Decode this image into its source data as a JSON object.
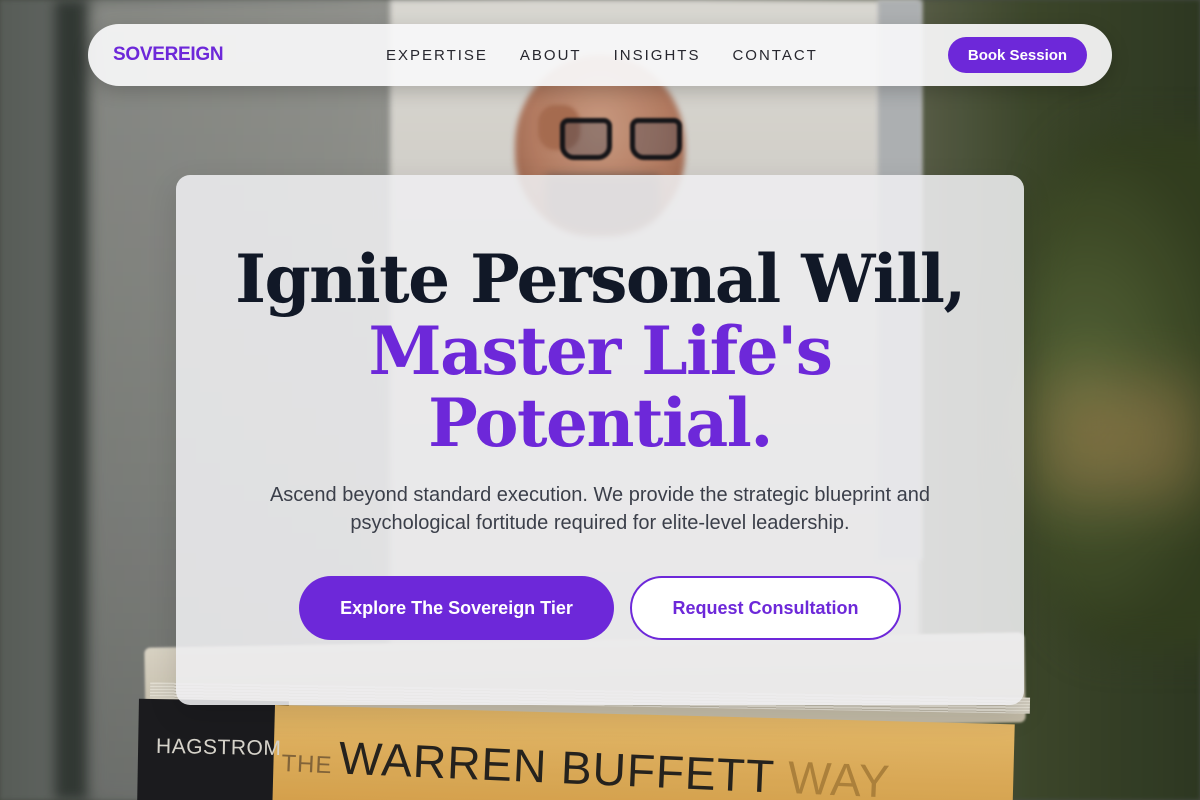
{
  "brand": {
    "name": "SOVEREIGN"
  },
  "nav": {
    "links": [
      "EXPERTISE",
      "ABOUT",
      "INSIGHTS",
      "CONTACT"
    ],
    "cta_label": "Book Session"
  },
  "hero": {
    "headline_line1": "Ignite Personal Will,",
    "headline_line2": "Master Life's",
    "headline_line3": "Potential.",
    "subtext": "Ascend beyond standard execution. We provide the strategic blueprint and psychological fortitude required for elite-level leadership.",
    "primary_cta": "Explore The Sovereign Tier",
    "secondary_cta": "Request Consultation"
  },
  "background": {
    "book_author": "HAGSTROM",
    "book_title_the": "THE",
    "book_title_main": "WARREN BUFFETT",
    "book_title_way": "WAY"
  },
  "colors": {
    "accent": "#6d28d9",
    "heading_dark": "#111827",
    "body_text": "#3b3f4a"
  }
}
